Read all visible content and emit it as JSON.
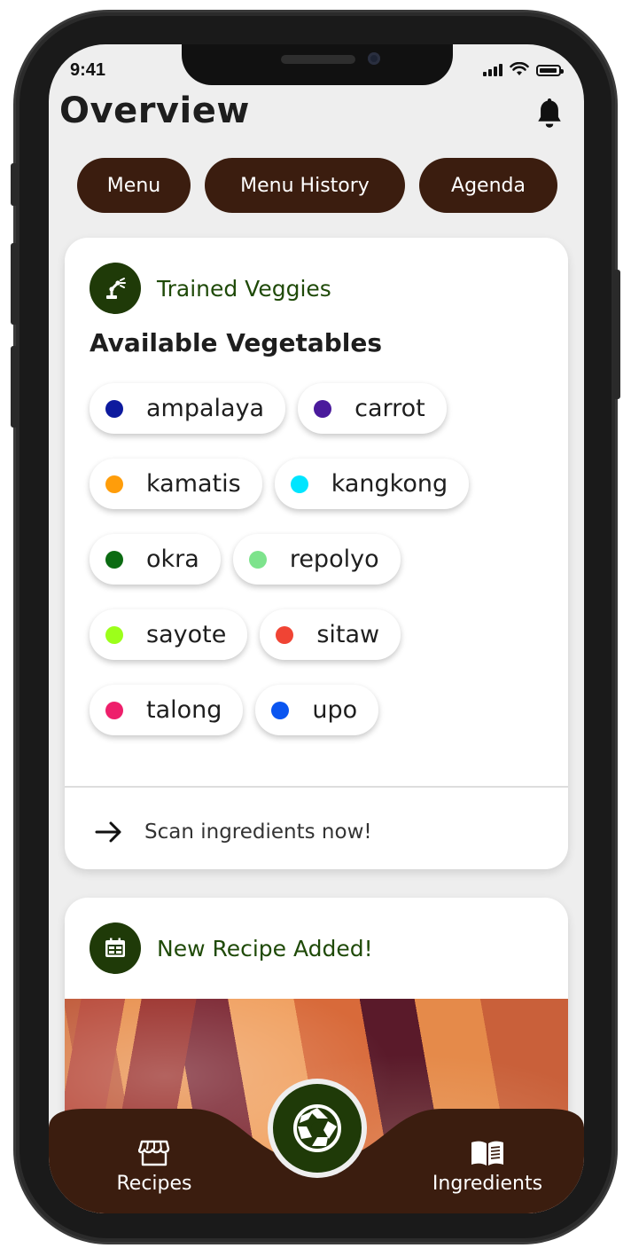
{
  "status_bar": {
    "time": "9:41"
  },
  "header": {
    "title": "Overview",
    "notification_icon": "bell-icon"
  },
  "nav_pills": [
    {
      "label": "Menu"
    },
    {
      "label": "Menu History"
    },
    {
      "label": "Agenda"
    }
  ],
  "trained_card": {
    "header_label": "Trained Veggies",
    "header_icon": "robot-arm-icon",
    "section_title": "Available Vegetables",
    "vegetables": [
      {
        "name": "ampalaya",
        "color": "#0d1a9e"
      },
      {
        "name": "carrot",
        "color": "#4a1a9c"
      },
      {
        "name": "kamatis",
        "color": "#ff9d0a"
      },
      {
        "name": "kangkong",
        "color": "#00e5ff"
      },
      {
        "name": "okra",
        "color": "#0b6b12"
      },
      {
        "name": "repolyo",
        "color": "#7de38c"
      },
      {
        "name": "sayote",
        "color": "#9cff1a"
      },
      {
        "name": "sitaw",
        "color": "#f04434"
      },
      {
        "name": "talong",
        "color": "#ee1f6b"
      },
      {
        "name": "upo",
        "color": "#0a55f0"
      }
    ],
    "scan_cta": "Scan ingredients now!"
  },
  "recipe_card": {
    "header_label": "New Recipe Added!",
    "header_icon": "calendar-icon",
    "image": "carrots-photo"
  },
  "bottom_nav": {
    "left": {
      "label": "Recipes",
      "icon": "store-icon"
    },
    "right": {
      "label": "Ingredients",
      "icon": "book-icon"
    },
    "center": {
      "icon": "camera-shutter-icon"
    }
  },
  "colors": {
    "brown": "#3b1d0f",
    "green": "#1f3a08",
    "background": "#eeeeee"
  }
}
